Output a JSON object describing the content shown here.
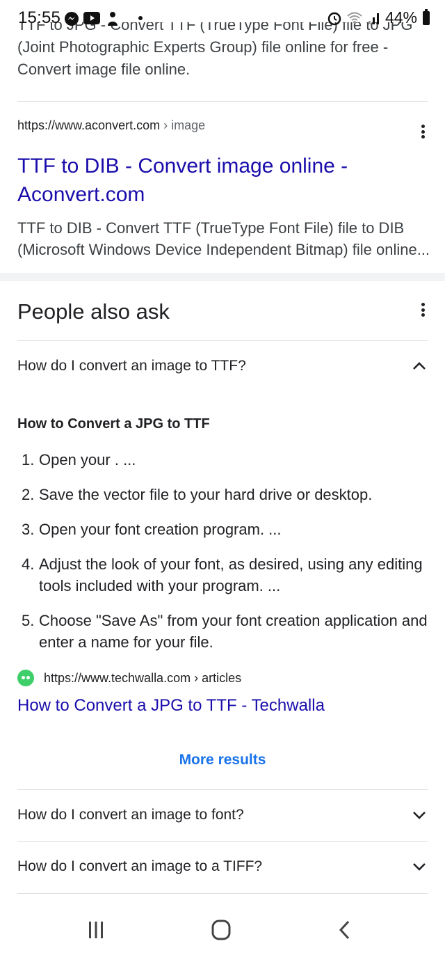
{
  "status_bar": {
    "time": "15:55",
    "left_icons": [
      "messenger-icon",
      "youtube-icon",
      "figure-icon",
      "dot-icon"
    ],
    "battery": "44%",
    "right_icons": [
      "alarm-icon",
      "wifi-icon",
      "signal-icon",
      "battery-icon"
    ]
  },
  "top_snippet": {
    "cut_line": "TTF to JPG - Convert TTF (TrueType Font File) file to JPG",
    "line2": "(Joint Photographic Experts Group) file online for free -",
    "line3": "Convert image file online."
  },
  "result": {
    "url_base": "https://www.aconvert.com",
    "url_crumb": " › image",
    "title": "TTF to DIB - Convert image online - Aconvert.com",
    "snippet": "TTF to DIB - Convert TTF (TrueType Font File) file to DIB (Microsoft Windows Device Independent Bitmap) file online..."
  },
  "people_also_ask": {
    "heading": "People also ask",
    "expanded_question": "How do I convert an image to TTF?",
    "answer_title": "How to Convert a JPG to TTF",
    "steps": [
      {
        "num": "1.",
        "text": "Open your . ..."
      },
      {
        "num": "2.",
        "text": "Save the vector file to your hard drive or desktop."
      },
      {
        "num": "3.",
        "text": "Open your font creation program. ..."
      },
      {
        "num": "4.",
        "text": "Adjust the look of your font, as desired, using any editing tools included with your program. ..."
      },
      {
        "num": "5.",
        "text": "Choose \"Save As\" from your font creation application and enter a name for your file."
      }
    ],
    "source_url": "https://www.techwalla.com › articles",
    "source_title": "How to Convert a JPG to TTF - Techwalla",
    "more_results": "More results",
    "questions": [
      "How do I convert an image to font?",
      "How do I convert an image to a TIFF?"
    ]
  },
  "colors": {
    "link": "#1a0dab",
    "accent": "#1a73e8",
    "divider": "#dadce0",
    "favicon": "#3ecf6a"
  },
  "nav_bar": {
    "buttons": [
      "recent-apps-icon",
      "home-icon",
      "back-icon"
    ]
  }
}
